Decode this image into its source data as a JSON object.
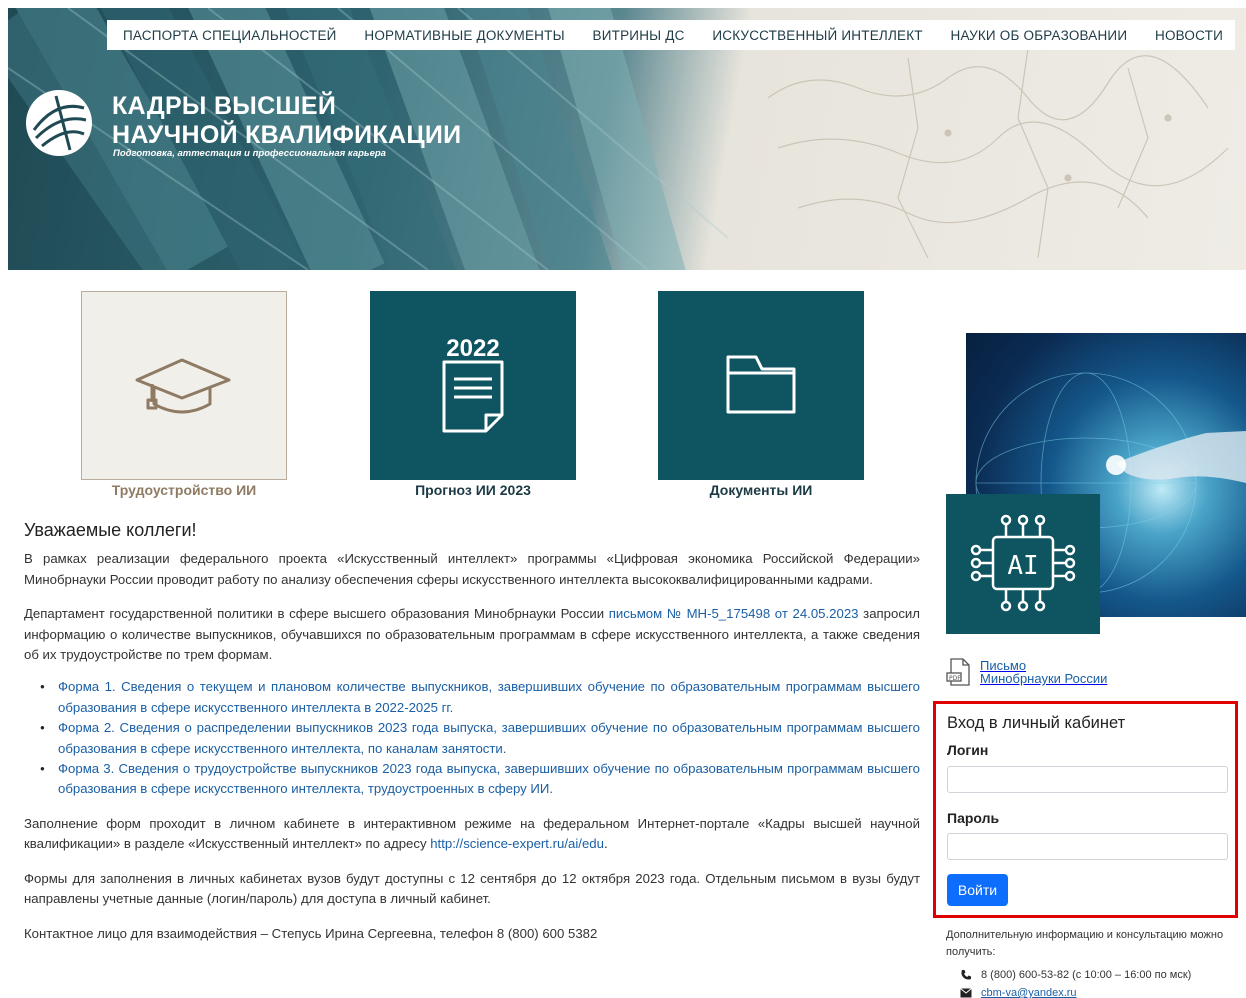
{
  "nav": {
    "items": [
      "ПАСПОРТА СПЕЦИАЛЬНОСТЕЙ",
      "НОРМАТИВНЫЕ ДОКУМЕНТЫ",
      "ВИТРИНЫ ДС",
      "ИСКУССТВЕННЫЙ ИНТЕЛЛЕКТ",
      "НАУКИ ОБ ОБРАЗОВАНИИ",
      "НОВОСТИ"
    ]
  },
  "header": {
    "title_line1": "КАДРЫ ВЫСШЕЙ",
    "title_line2": "НАУЧНОЙ КВАЛИФИКАЦИИ",
    "subtitle": "Подготовка, аттестация и профессиональная карьера"
  },
  "tiles": [
    {
      "label": "Трудоустройство ИИ",
      "icon": "graduation-cap-icon",
      "label_color": "#8f7b63"
    },
    {
      "label": "Прогноз ИИ 2023",
      "icon": "document-icon",
      "year": "2022",
      "label_color": "#1c3a44"
    },
    {
      "label": "Документы ИИ",
      "icon": "folder-icon",
      "label_color": "#1c3a44"
    }
  ],
  "content": {
    "heading": "Уважаемые коллеги!",
    "p1": "В рамках реализации федерального проекта «Искусственный интеллект» программы «Цифровая экономика Российской Федерации» Минобрнауки России проводит работу по анализу обеспечения сферы искусственного интеллекта высококвалифицированными кадрами.",
    "p2_before": "Департамент государственной политики в сфере высшего образования Минобрнауки России ",
    "p2_link": "письмом № МН-5_175498 от 24.05.2023",
    "p2_after": " запросил информацию о количестве выпускников, обучавшихся по образовательным программам в сфере искусственного интеллекта, а также сведения об их трудоустройстве по трем формам.",
    "forms": [
      "Форма 1. Сведения о текущем и плановом количестве выпускников, завершивших обучение по образовательным программам высшего образования в сфере искусственного интеллекта в 2022-2025 гг.",
      "Форма 2. Сведения о распределении выпускников 2023 года выпуска, завершивших обучение по образовательным программам высшего образования в сфере искусственного интеллекта, по каналам занятости.",
      "Форма 3. Сведения о трудоустройстве выпускников 2023 года выпуска, завершивших обучение по образовательным программам высшего образования в сфере искусственного интеллекта, трудоустроенных в сферу ИИ."
    ],
    "p3_before": "Заполнение форм проходит в личном кабинете в интерактивном режиме на федеральном Интернет-портале «Кадры высшей научной квалификации» в разделе «Искусственный интеллект» по адресу ",
    "p3_link": "http://science-expert.ru/ai/edu",
    "p3_after": ".",
    "p4": "Формы для заполнения в личных кабинетах вузов будут доступны с 12 сентября до 12 октября 2023 года. Отдельным письмом в вузы будут направлены учетные данные (логин/пароль) для доступа в личный кабинет.",
    "p5": "Контактное лицо для взаимодействия – Степусь Ирина Сергеевна, телефон 8 (800) 600 5382"
  },
  "sidebar": {
    "ai_badge_text": "AI",
    "letter_line1": "Письмо",
    "letter_line2": "Минобрнауки России",
    "login": {
      "title": "Вход в личный кабинет",
      "login_label": "Логин",
      "password_label": "Пароль",
      "button": "Войти"
    },
    "info_text": "Дополнительную информацию и консультацию можно получить:",
    "phone": "8 (800) 600-53-82 (с 10:00 – 16:00 по мск)",
    "email": "cbm-va@yandex.ru"
  },
  "colors": {
    "teal": "#0f5461",
    "link": "#1a5fa5",
    "button": "#0d6efd",
    "highlight_border": "#e00000"
  }
}
